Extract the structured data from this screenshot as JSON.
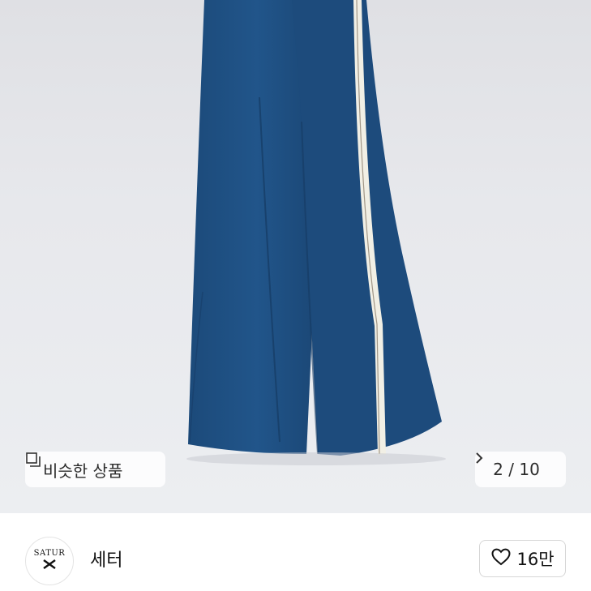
{
  "product": {
    "similar_label": "비슷한 상품",
    "pager": "2 / 10"
  },
  "seller": {
    "logo_text": "SATUR",
    "name": "세터",
    "likes": "16만"
  },
  "colors": {
    "pants": "#1e4d7e",
    "stripe": "#f2f0e6",
    "background": "#e6e7eb"
  },
  "icons": {
    "similar": "square-stack-icon",
    "pager": "chevron-right-icon",
    "like": "heart-outline-icon"
  }
}
